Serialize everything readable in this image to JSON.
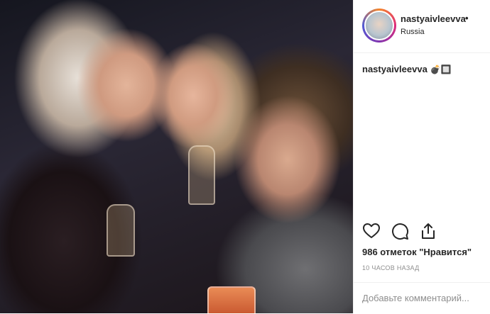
{
  "post": {
    "username": "nastyaivleevva",
    "separator": "•",
    "location": "Russia",
    "caption_user": "nastyaivleevva",
    "caption_emoji": "💣🔲",
    "likes": "986 отметок \"Нравится\"",
    "time": "10 ЧАСОВ НАЗАД"
  },
  "comment": {
    "placeholder": "Добавьте комментарий..."
  },
  "icons": [
    "heart-icon",
    "comment-icon",
    "share-icon"
  ]
}
